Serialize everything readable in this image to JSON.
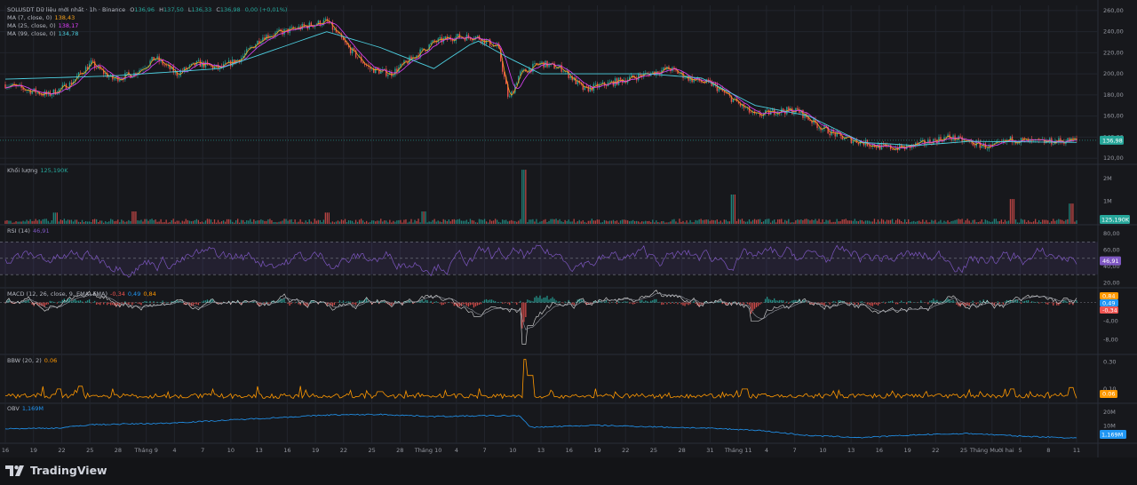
{
  "header": {
    "symbol": "SOLUSDT Dữ liệu mới nhất · 1h · Binance",
    "ohlc": {
      "o_label": "O",
      "o": "136,96",
      "h_label": "H",
      "h": "137,50",
      "l_label": "L",
      "l": "136,33",
      "c_label": "C",
      "c": "136,98",
      "chg": "0,00 (+0,01%)"
    },
    "ma": [
      {
        "label": "MA (7, close, 0)",
        "value": "138,43",
        "color": "#f7a21b"
      },
      {
        "label": "MA (25, close, 0)",
        "value": "138,17",
        "color": "#e040fb"
      },
      {
        "label": "MA (99, close, 0)",
        "value": "134,78",
        "color": "#4dd0e1"
      }
    ]
  },
  "panes": {
    "price": {
      "ticks": [
        "260,00",
        "240,00",
        "220,00",
        "200,00",
        "180,00",
        "160,00",
        "140,00",
        "120,00"
      ],
      "tick_values": [
        260,
        240,
        220,
        200,
        180,
        160,
        140,
        120
      ],
      "last": "136,98",
      "last_value": 136.98
    },
    "volume": {
      "label": "Khối lượng",
      "value": "125,190K",
      "ticks": [
        "2M",
        "1M"
      ],
      "tick_values": [
        2000000,
        1000000
      ],
      "last": "125,190K"
    },
    "rsi": {
      "label": "RSI (14)",
      "value": "46,91",
      "ticks": [
        "80,00",
        "60,00",
        "40,00",
        "20,00"
      ],
      "tick_values": [
        80,
        60,
        40,
        20
      ],
      "last": "46,91",
      "last_value": 46.91,
      "upper": 70,
      "lower": 30
    },
    "macd": {
      "label": "MACD (12, 26, close, 9, EMA, EMA)",
      "values": [
        "-0,34",
        "0,49",
        "0,84"
      ],
      "ticks": [
        "-4,00",
        "-8,00"
      ],
      "tick_values": [
        -4,
        -8
      ],
      "badges": [
        "0,84",
        "0,49",
        "-0,34"
      ]
    },
    "bbw": {
      "label": "BBW (20, 2)",
      "value": "0.06",
      "ticks": [
        "0.30",
        "0.10"
      ],
      "tick_values": [
        0.3,
        0.1
      ],
      "last": "0.06"
    },
    "obv": {
      "label": "OBV",
      "value": "1,169M",
      "ticks": [
        "20M",
        "10M"
      ],
      "tick_values": [
        20000000,
        10000000
      ],
      "last": "1,169M"
    }
  },
  "x_axis": [
    "16",
    "19",
    "22",
    "25",
    "28",
    "Tháng 9",
    "4",
    "7",
    "10",
    "13",
    "16",
    "19",
    "22",
    "25",
    "28",
    "Tháng 10",
    "4",
    "7",
    "10",
    "13",
    "16",
    "19",
    "22",
    "25",
    "28",
    "31",
    "Tháng 11",
    "4",
    "7",
    "10",
    "13",
    "16",
    "19",
    "22",
    "25",
    "Tháng Mười hai",
    "5",
    "8",
    "11"
  ],
  "footer": {
    "brand": "TradingView"
  },
  "chart_data": {
    "type": "line",
    "title": "SOLUSDT Dữ liệu mới nhất · 1h · Binance",
    "x_categories": [
      "16",
      "19",
      "22",
      "25",
      "28",
      "Tháng 9",
      "4",
      "7",
      "10",
      "13",
      "16",
      "19",
      "22",
      "25",
      "28",
      "Tháng 10",
      "4",
      "7",
      "10",
      "13",
      "16",
      "19",
      "22",
      "25",
      "28",
      "31",
      "Tháng 11",
      "4",
      "7",
      "10",
      "13",
      "16",
      "19",
      "22",
      "25",
      "Tháng Mười hai",
      "5",
      "8",
      "11"
    ],
    "price_ylim": [
      115,
      265
    ],
    "price_path": [
      [
        0,
        190
      ],
      [
        0.02,
        185
      ],
      [
        0.04,
        180
      ],
      [
        0.06,
        190
      ],
      [
        0.08,
        210
      ],
      [
        0.1,
        195
      ],
      [
        0.12,
        200
      ],
      [
        0.14,
        215
      ],
      [
        0.16,
        200
      ],
      [
        0.18,
        210
      ],
      [
        0.2,
        205
      ],
      [
        0.22,
        215
      ],
      [
        0.24,
        235
      ],
      [
        0.26,
        240
      ],
      [
        0.28,
        245
      ],
      [
        0.3,
        250
      ],
      [
        0.32,
        225
      ],
      [
        0.34,
        205
      ],
      [
        0.36,
        200
      ],
      [
        0.38,
        215
      ],
      [
        0.4,
        230
      ],
      [
        0.42,
        235
      ],
      [
        0.44,
        235
      ],
      [
        0.46,
        225
      ],
      [
        0.47,
        175
      ],
      [
        0.48,
        200
      ],
      [
        0.5,
        210
      ],
      [
        0.52,
        205
      ],
      [
        0.54,
        185
      ],
      [
        0.56,
        190
      ],
      [
        0.58,
        195
      ],
      [
        0.6,
        200
      ],
      [
        0.62,
        205
      ],
      [
        0.64,
        195
      ],
      [
        0.66,
        190
      ],
      [
        0.68,
        175
      ],
      [
        0.7,
        160
      ],
      [
        0.72,
        165
      ],
      [
        0.74,
        165
      ],
      [
        0.76,
        150
      ],
      [
        0.78,
        140
      ],
      [
        0.8,
        135
      ],
      [
        0.82,
        130
      ],
      [
        0.84,
        130
      ],
      [
        0.86,
        135
      ],
      [
        0.88,
        140
      ],
      [
        0.9,
        135
      ],
      [
        0.92,
        130
      ],
      [
        0.94,
        138
      ],
      [
        0.96,
        135
      ],
      [
        0.98,
        136
      ],
      [
        1,
        137
      ]
    ],
    "ma99_path": [
      [
        0,
        195
      ],
      [
        0.1,
        198
      ],
      [
        0.2,
        205
      ],
      [
        0.3,
        240
      ],
      [
        0.35,
        225
      ],
      [
        0.4,
        205
      ],
      [
        0.44,
        232
      ],
      [
        0.47,
        215
      ],
      [
        0.5,
        200
      ],
      [
        0.6,
        200
      ],
      [
        0.65,
        196
      ],
      [
        0.7,
        170
      ],
      [
        0.75,
        160
      ],
      [
        0.8,
        135
      ],
      [
        0.85,
        132
      ],
      [
        0.9,
        136
      ],
      [
        1,
        135
      ]
    ],
    "series": [
      {
        "name": "MA (7, close, 0)",
        "last": 138.43
      },
      {
        "name": "MA (25, close, 0)",
        "last": 138.17
      },
      {
        "name": "MA (99, close, 0)",
        "last": 134.78
      }
    ],
    "volume_spikes": [
      [
        0.047,
        0.5
      ],
      [
        0.12,
        0.55
      ],
      [
        0.3,
        0.5
      ],
      [
        0.39,
        0.55
      ],
      [
        0.484,
        2.4
      ],
      [
        0.68,
        1.3
      ],
      [
        0.94,
        1.1
      ],
      [
        0.995,
        0.9
      ]
    ],
    "rsi_ylim": [
      15,
      90
    ],
    "macd_ylim": [
      -11,
      3
    ],
    "macd_spikes": [
      [
        0.486,
        -9
      ],
      [
        0.49,
        -5
      ],
      [
        0.44,
        -3
      ],
      [
        0.7,
        -4
      ]
    ],
    "bbw_ylim": [
      0,
      0.35
    ],
    "bbw_spikes": [
      [
        0.05,
        0.1
      ],
      [
        0.07,
        0.12
      ],
      [
        0.35,
        0.08
      ],
      [
        0.486,
        0.32
      ],
      [
        0.49,
        0.2
      ],
      [
        0.69,
        0.1
      ],
      [
        0.94,
        0.1
      ],
      [
        0.995,
        0.11
      ]
    ],
    "obv_ylim": [
      -2000000,
      26000000
    ],
    "obv_path": [
      [
        0,
        8000000
      ],
      [
        0.05,
        8500000
      ],
      [
        0.08,
        11000000
      ],
      [
        0.15,
        12000000
      ],
      [
        0.25,
        16000000
      ],
      [
        0.3,
        18000000
      ],
      [
        0.35,
        18500000
      ],
      [
        0.4,
        17000000
      ],
      [
        0.45,
        17500000
      ],
      [
        0.48,
        17500000
      ],
      [
        0.49,
        9000000
      ],
      [
        0.55,
        10500000
      ],
      [
        0.6,
        9500000
      ],
      [
        0.65,
        8500000
      ],
      [
        0.7,
        7000000
      ],
      [
        0.75,
        3000000
      ],
      [
        0.8,
        1500000
      ],
      [
        0.85,
        3500000
      ],
      [
        0.9,
        4500000
      ],
      [
        0.95,
        2500000
      ],
      [
        1,
        1169000
      ]
    ]
  }
}
